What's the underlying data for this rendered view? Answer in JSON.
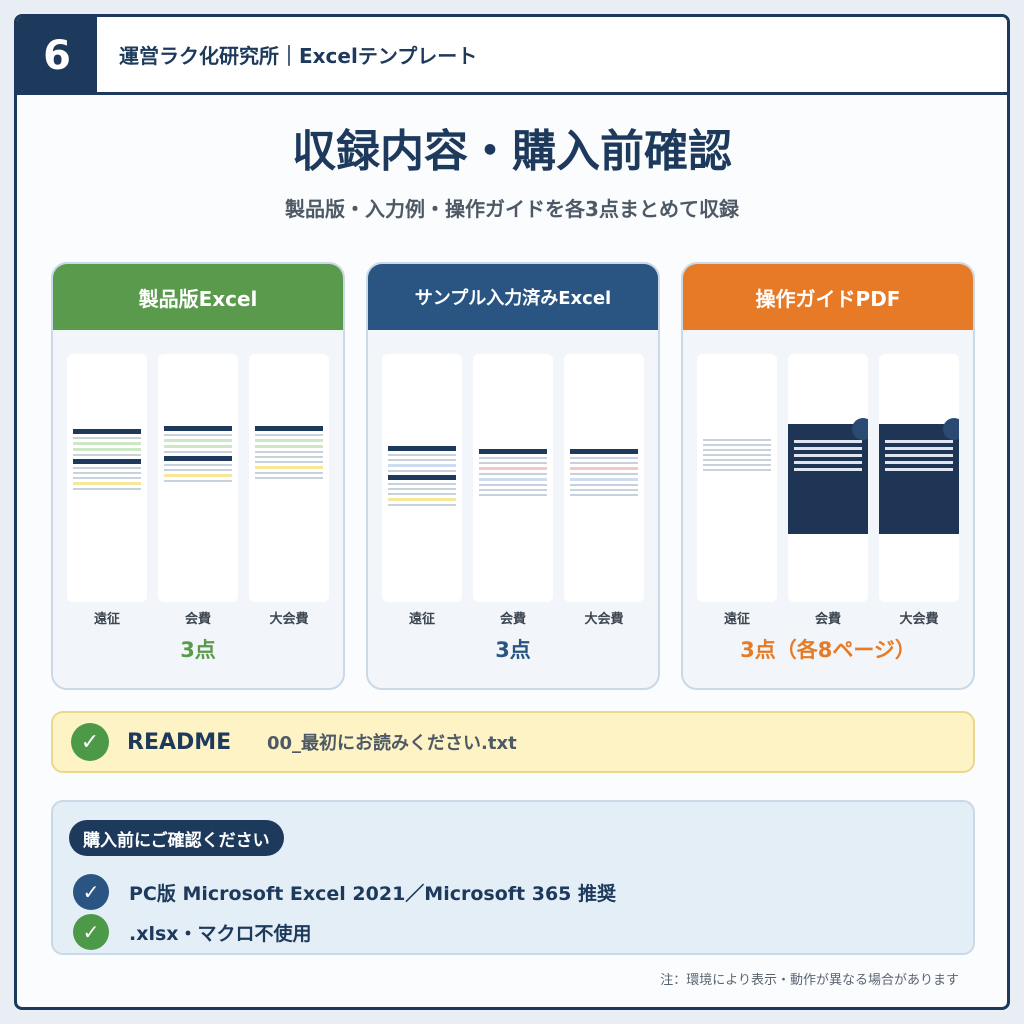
{
  "header": {
    "number": "6",
    "label": "運営ラク化研究所｜Excelテンプレート"
  },
  "title": "収録内容・購入前確認",
  "subtitle": "製品版・入力例・操作ガイドを各3点まとめて収録",
  "colors": {
    "navy": "#1d3a5c",
    "green": "#5a9a4c",
    "blue": "#2a5582",
    "orange": "#e67a26"
  },
  "cards": [
    {
      "heading": "製品版Excel",
      "labels": [
        "遠征",
        "会費",
        "大会費"
      ],
      "count": "3点",
      "color": "#5a9a4c"
    },
    {
      "heading": "サンプル入力済みExcel",
      "labels": [
        "遠征",
        "会費",
        "大会費"
      ],
      "count": "3点",
      "color": "#2a5582"
    },
    {
      "heading": "操作ガイドPDF",
      "labels": [
        "遠征",
        "会費",
        "大会費"
      ],
      "count": "3点（各8ページ）",
      "color": "#e67a26"
    }
  ],
  "readme": {
    "label": "README",
    "file": "00_最初にお読みください.txt",
    "icon": "check-icon"
  },
  "notes": {
    "heading": "購入前にご確認ください",
    "items": [
      "PC版 Microsoft Excel 2021／Microsoft 365 推奨",
      ".xlsx・マクロ不使用"
    ]
  },
  "footnote": "注：環境により表示・動作が異なる場合があります"
}
